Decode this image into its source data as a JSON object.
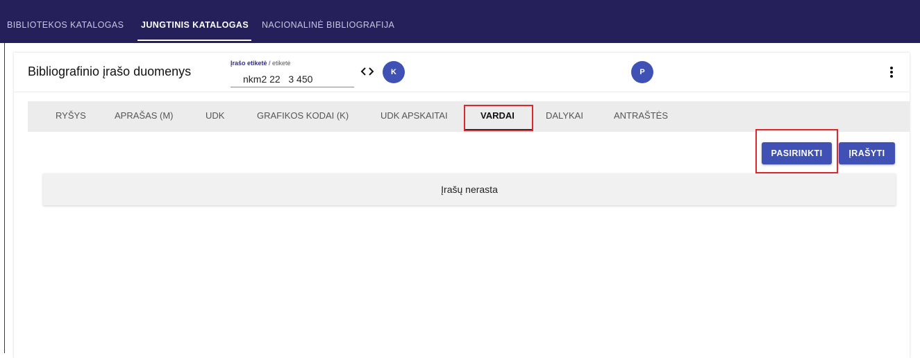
{
  "top_nav": {
    "items": [
      {
        "label": "BIBLIOTEKOS KATALOGAS",
        "active": false
      },
      {
        "label": "JUNGTINIS KATALOGAS",
        "active": true
      },
      {
        "label": "NACIONALINĖ BIBLIOGRAFIJA",
        "active": false
      }
    ]
  },
  "header": {
    "title": "Bibliografinio įrašo duomenys",
    "field": {
      "label_strong": "Įrašo etiketė",
      "label_sep": " / ",
      "label_weak": "etiketė",
      "value": "nkm2 22   3 450"
    },
    "code_icon": "code-brackets-icon",
    "avatar_left": "K",
    "avatar_right": "P",
    "menu_icon": "more-vert-icon"
  },
  "tabs": [
    {
      "label": "RYŠYS"
    },
    {
      "label": "APRAŠAS (M)"
    },
    {
      "label": "UDK"
    },
    {
      "label": "GRAFIKOS KODAI (K)"
    },
    {
      "label": "UDK APSKAITAI"
    },
    {
      "label": "VARDAI",
      "active": true
    },
    {
      "label": "DALYKAI"
    },
    {
      "label": "ANTRAŠTĖS"
    }
  ],
  "actions": {
    "pasirinkti": "PASIRINKTI",
    "irasyti": "ĮRAŠYTI"
  },
  "empty_message": "Įrašų nerasta",
  "colors": {
    "top_bar": "#25205a",
    "primary": "#3f51b5",
    "highlight": "#e0262c"
  }
}
